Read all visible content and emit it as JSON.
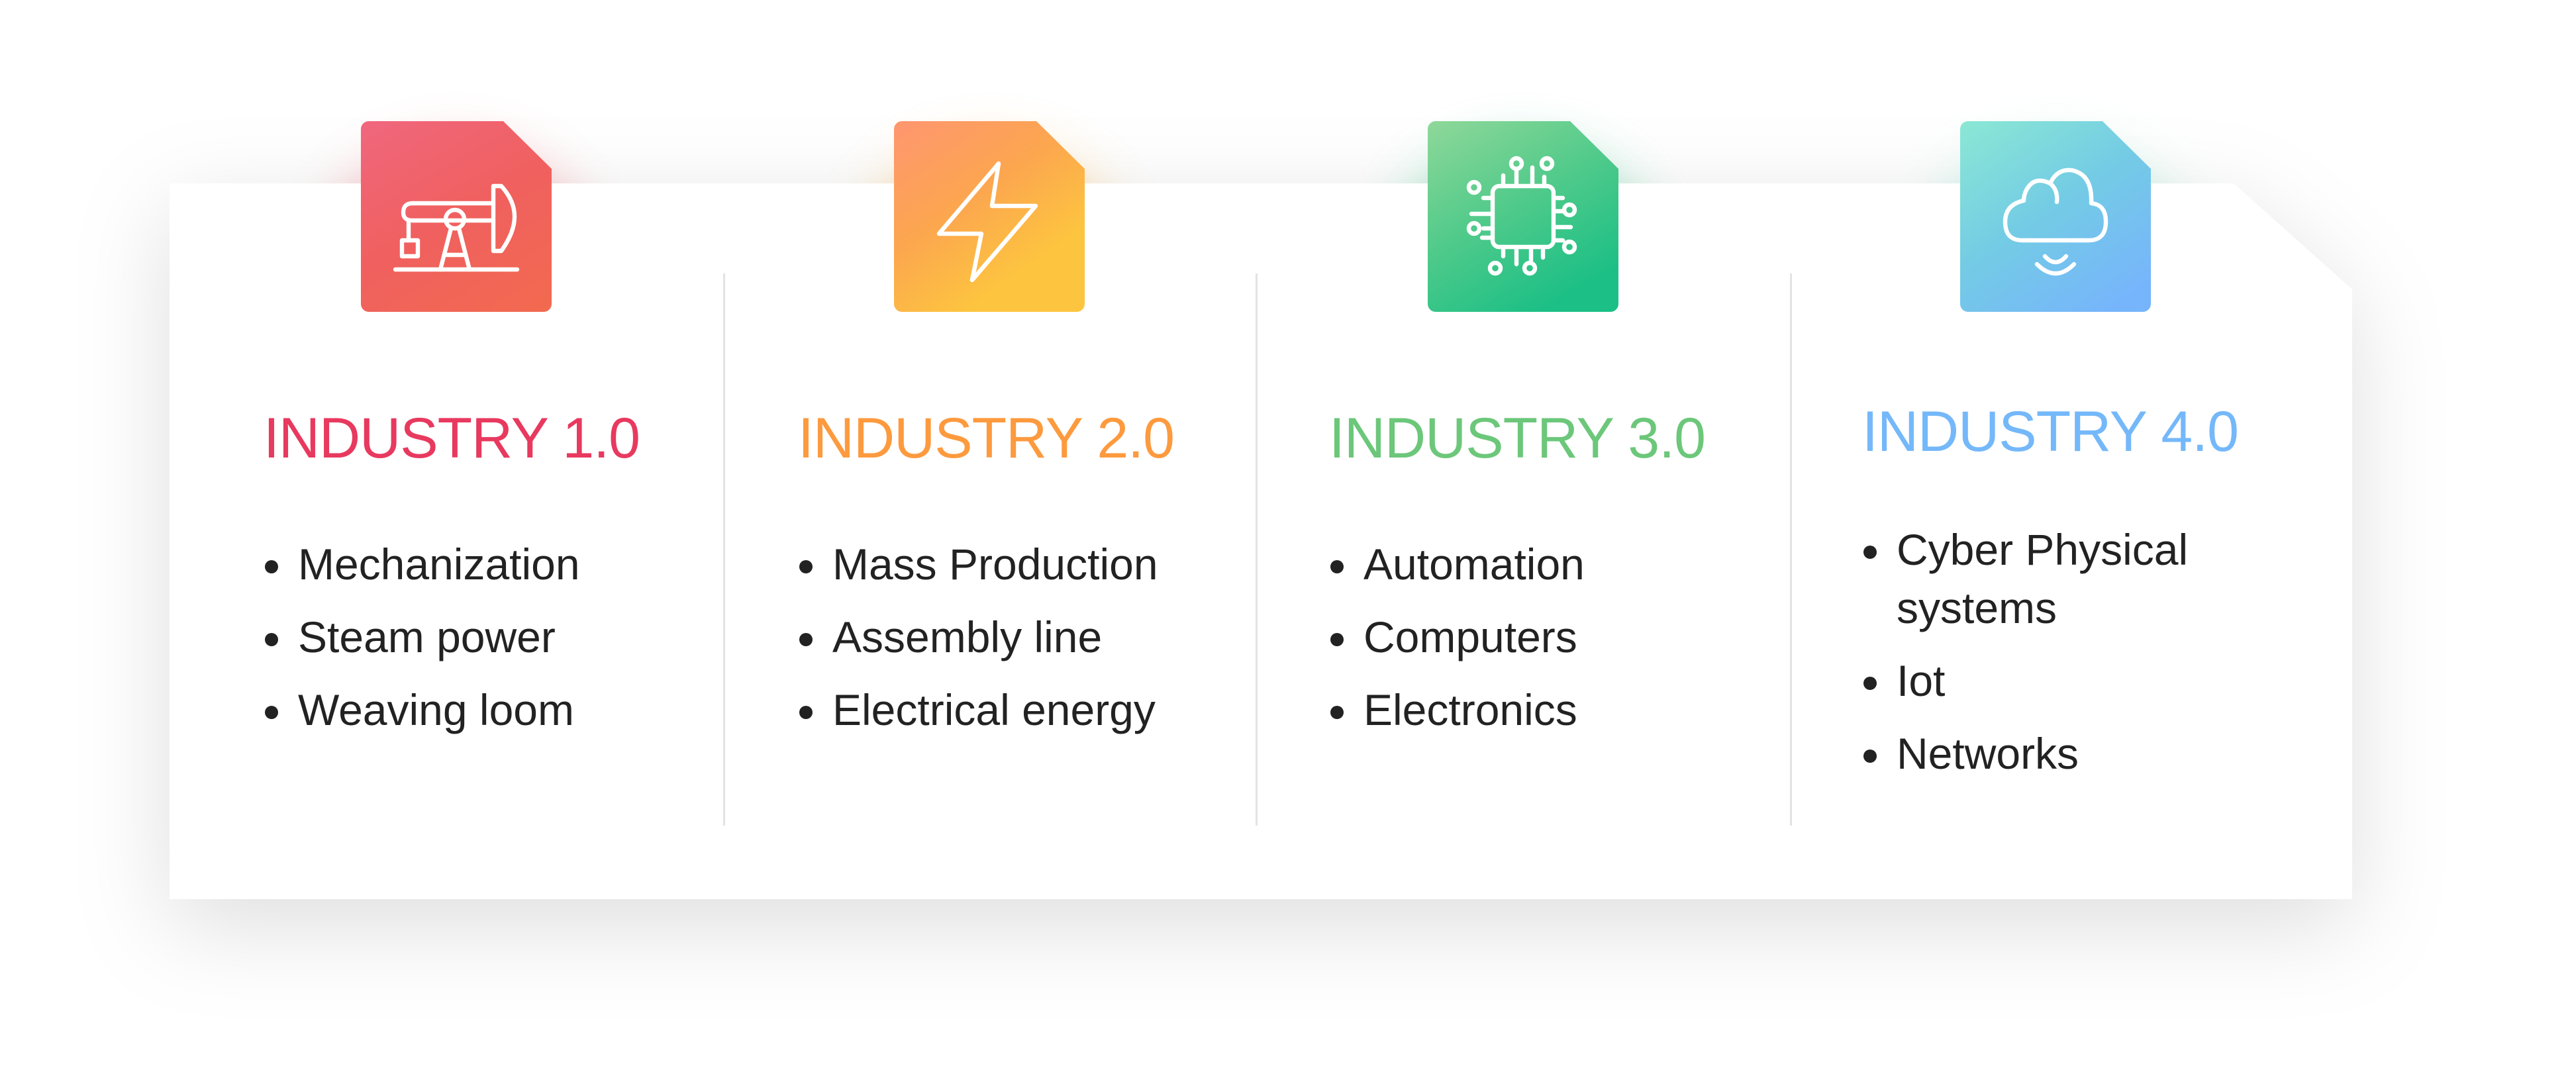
{
  "columns": [
    {
      "title": "INDUSTRY 1.0",
      "color": "#E8395F",
      "icon": "oil-pump-icon",
      "items": [
        "Mechanization",
        "Steam power",
        "Weaving loom"
      ]
    },
    {
      "title": "INDUSTRY 2.0",
      "color": "#FD9A3E",
      "icon": "lightning-bolt-icon",
      "items": [
        "Mass Production",
        "Assembly line",
        "Electrical energy"
      ]
    },
    {
      "title": "INDUSTRY 3.0",
      "color": "#6CC77A",
      "icon": "microchip-icon",
      "items": [
        "Automation",
        "Computers",
        "Electronics"
      ]
    },
    {
      "title": "INDUSTRY 4.0",
      "color": "#74B8FA",
      "icon": "cloud-wireless-icon",
      "items": [
        "Cyber Physical systems",
        "Iot",
        "Networks"
      ]
    }
  ]
}
